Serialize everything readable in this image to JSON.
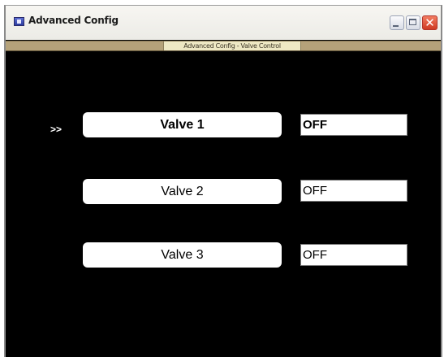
{
  "window": {
    "title": "Advanced Config",
    "close_glyph": "✕",
    "icons": [
      "app-icon",
      "minimize-icon",
      "maximize-icon",
      "close-icon"
    ]
  },
  "subheader": {
    "label": "Advanced Config - Valve Control"
  },
  "selection_marker": ">>",
  "valves": [
    {
      "label": "Valve 1",
      "status": "OFF",
      "selected": true
    },
    {
      "label": "Valve 2",
      "status": "OFF",
      "selected": false
    },
    {
      "label": "Valve 3",
      "status": "OFF",
      "selected": false
    }
  ],
  "colors": {
    "background": "#000000",
    "subheader_bar": "#b5a27a",
    "subheader_label_bg": "#eee8c4",
    "close_button": "#cf3a22",
    "button_face": "#ffffff"
  }
}
